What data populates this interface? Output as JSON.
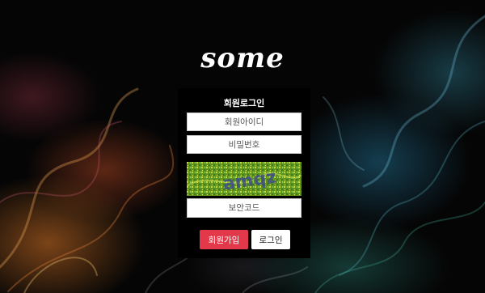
{
  "brand": {
    "logo_text": "some"
  },
  "login": {
    "title": "회원로그인",
    "id_placeholder": "회원아이디",
    "password_placeholder": "비밀번호",
    "captcha_text": "amqz",
    "captcha_code_placeholder": "보안코드",
    "signup_label": "회원가입",
    "login_label": "로그인"
  },
  "colors": {
    "signup_button": "#e2394a",
    "login_button": "#ffffff",
    "panel_background": "#000000",
    "captcha_background": "#5f9622"
  }
}
